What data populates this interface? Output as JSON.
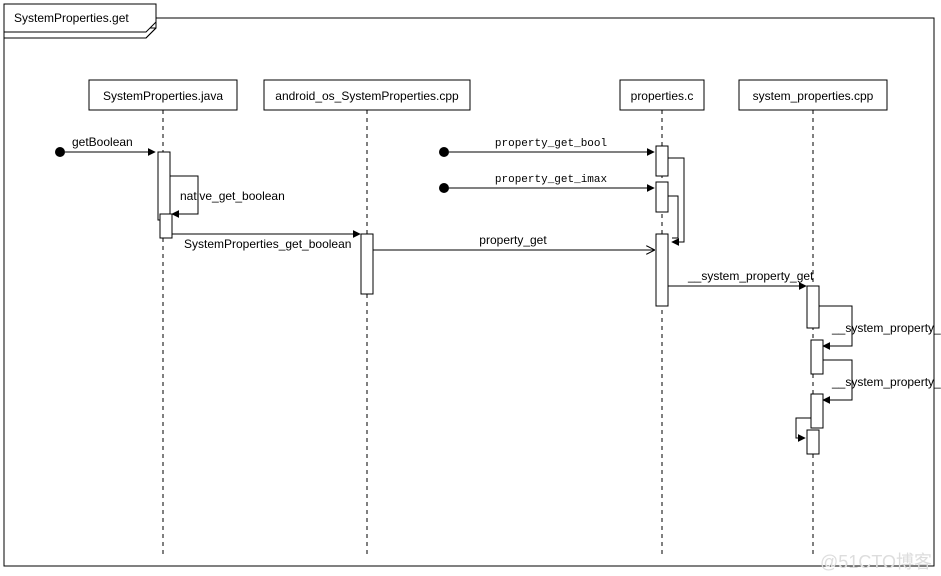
{
  "title": "SystemProperties.get",
  "participants": {
    "p1": "SystemProperties.java",
    "p2": "android_os_SystemProperties.cpp",
    "p3": "properties.c",
    "p4": "system_properties.cpp"
  },
  "messages": {
    "m_start": "getBoolean",
    "m_prop_get_bool": "property_get_bool",
    "m_prop_get_imax": "property_get_imax",
    "m_native_get_boolean": "native_get_boolean",
    "m_sysprops_get_bool": "SystemProperties_get_boolean",
    "m_property_get": "property_get",
    "m_sys_prop_get": "__system_property_get",
    "m_sys_prop_read_1": "__system_property_read",
    "m_sys_prop_read_2": "__system_property_read"
  },
  "watermark": "@51CTO博客"
}
